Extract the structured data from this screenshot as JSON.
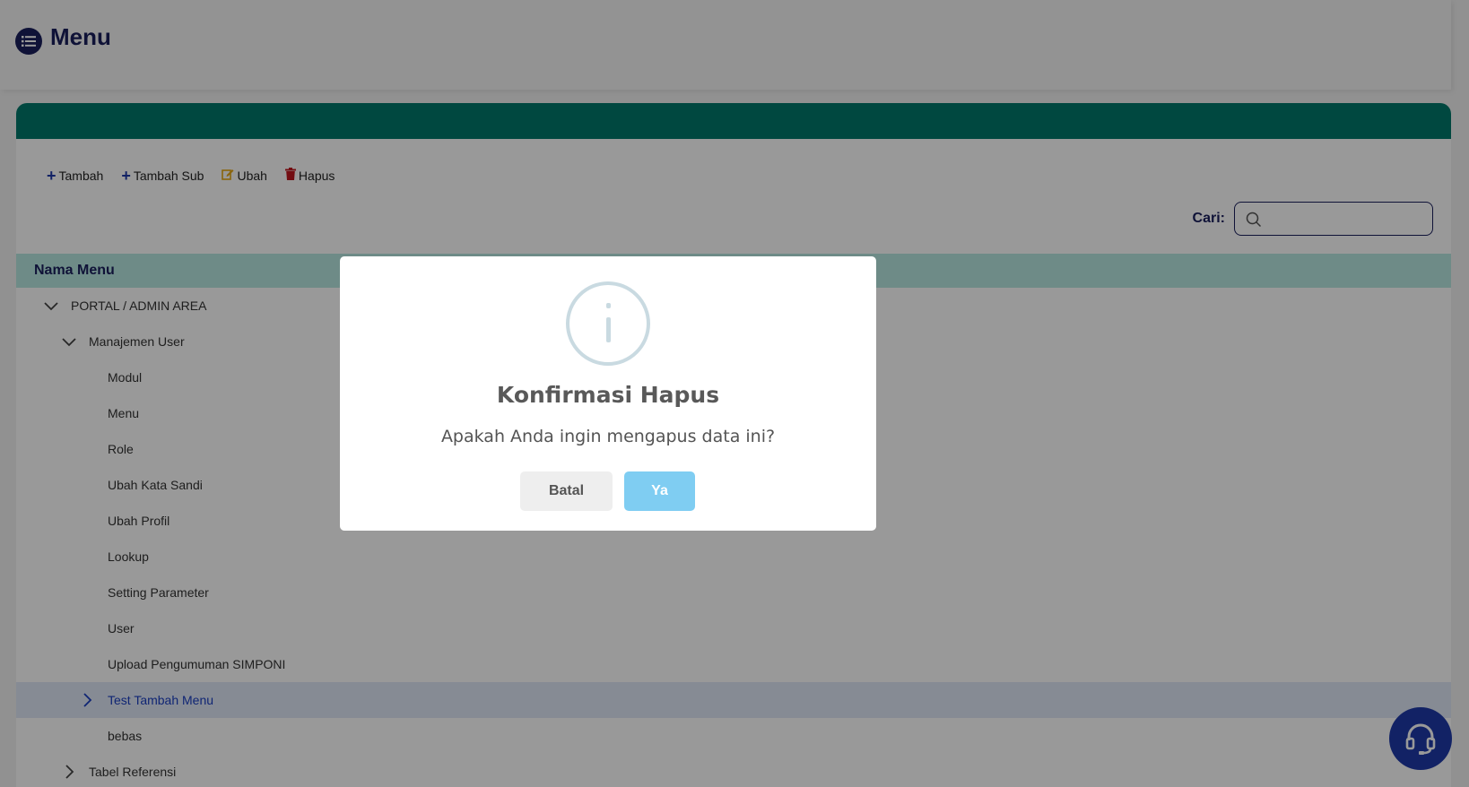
{
  "header": {
    "title": "Menu",
    "icon": "list-icon"
  },
  "toolbar": {
    "add_label": "Tambah",
    "add_sub_label": "Tambah Sub",
    "edit_label": "Ubah",
    "delete_label": "Hapus"
  },
  "search": {
    "label": "Cari:",
    "value": "",
    "placeholder": ""
  },
  "table": {
    "header": "Nama Menu",
    "rows": [
      {
        "label": "PORTAL / ADMIN AREA",
        "expanded": true
      },
      {
        "label": "Manajemen User",
        "expanded": true
      },
      {
        "label": "Modul"
      },
      {
        "label": "Menu"
      },
      {
        "label": "Role"
      },
      {
        "label": "Ubah Kata Sandi"
      },
      {
        "label": "Ubah Profil"
      },
      {
        "label": "Lookup"
      },
      {
        "label": "Setting Parameter"
      },
      {
        "label": "User"
      },
      {
        "label": "Upload Pengumuman SIMPONI"
      },
      {
        "label": "Test Tambah Menu",
        "expanded": false,
        "selected": true
      },
      {
        "label": "bebas"
      },
      {
        "label": "Tabel Referensi",
        "expanded": false
      }
    ]
  },
  "modal": {
    "title": "Konfirmasi Hapus",
    "message": "Apakah Anda ingin mengapus data ini?",
    "cancel_label": "Batal",
    "confirm_label": "Ya",
    "icon": "info-icon"
  },
  "colors": {
    "primary": "#1a1f5c",
    "card_header": "#00796b",
    "table_header": "#b8e8e2",
    "confirm": "#7fcdf2",
    "fab": "#1f3aa8"
  }
}
